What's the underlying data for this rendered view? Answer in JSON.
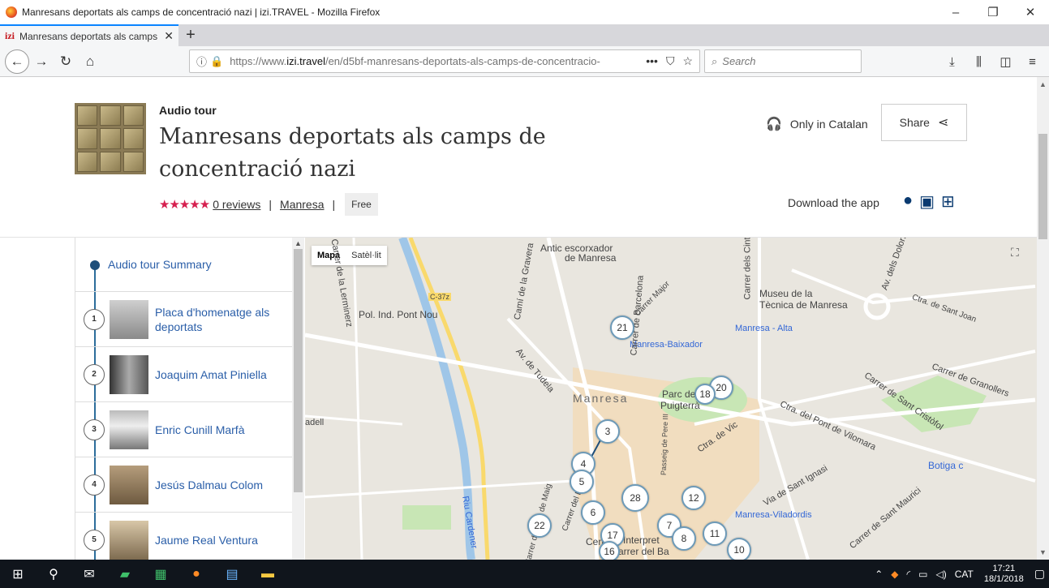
{
  "window": {
    "title": "Manresans deportats als camps de concentració nazi | izi.TRAVEL - Mozilla Firefox"
  },
  "tab": {
    "favicon_text": "izi",
    "title": "Manresans deportats als camps",
    "close": "✕",
    "newtab": "+"
  },
  "nav": {
    "url_prefix": "https://www.",
    "url_domain": "izi.travel",
    "url_rest": "/en/d5bf-manresans-deportats-als-camps-de-concentracio-",
    "search_placeholder": "Search"
  },
  "tour": {
    "type": "Audio tour",
    "title": "Manresans deportats als camps de concentració nazi",
    "stars": "★★★★★",
    "reviews": "0 reviews",
    "city": "Manresa",
    "price": "Free",
    "language": "Only in Catalan",
    "share": "Share",
    "download": "Download the app"
  },
  "sidebar": {
    "summary": "Audio tour Summary",
    "stops": [
      {
        "num": "1",
        "label": "Placa d'homenatge als deportats"
      },
      {
        "num": "2",
        "label": "Joaquim Amat Piniella"
      },
      {
        "num": "3",
        "label": "Enric Cunill Marfà"
      },
      {
        "num": "4",
        "label": "Jesús Dalmau Colom"
      },
      {
        "num": "5",
        "label": "Jaume Real Ventura"
      }
    ]
  },
  "map": {
    "type_map": "Mapa",
    "type_sat": "Satèl·lit",
    "labels": [
      {
        "text": "Antic escorxador",
        "cls": ""
      },
      {
        "text": "de Manresa",
        "cls": ""
      },
      {
        "text": "Museu de la",
        "cls": ""
      },
      {
        "text": "Tècnica de Manresa",
        "cls": ""
      },
      {
        "text": "Pol. Ind. Pont Nou",
        "cls": ""
      },
      {
        "text": "Manresa - Alta",
        "cls": "blue"
      },
      {
        "text": "Manresa-Baixador",
        "cls": "blue"
      },
      {
        "text": "Manresa",
        "cls": "big"
      },
      {
        "text": "Parc de",
        "cls": ""
      },
      {
        "text": "Puigterrà",
        "cls": ""
      },
      {
        "text": "Botiga c",
        "cls": "blue"
      },
      {
        "text": "Manresa-Viladordis",
        "cls": "blue"
      },
      {
        "text": "Riu Cardener",
        "cls": "blue"
      },
      {
        "text": "C-37z",
        "cls": ""
      },
      {
        "text": "Ctra. de Vic",
        "cls": ""
      },
      {
        "text": "Carrer de Granollers",
        "cls": ""
      },
      {
        "text": "Av. de Tudela",
        "cls": ""
      },
      {
        "text": "Carrer dels Cintaires",
        "cls": ""
      },
      {
        "text": "Av. dels Dolors",
        "cls": ""
      },
      {
        "text": "Ctra. del Pont de Vilomara",
        "cls": ""
      },
      {
        "text": "Carrer de Sant Cristòfol",
        "cls": ""
      },
      {
        "text": "Carrer de Barcelona",
        "cls": ""
      },
      {
        "text": "Camí de la Gravera",
        "cls": ""
      },
      {
        "text": "Carrer de la Lerminerz",
        "cls": ""
      },
      {
        "text": "Via de Sant Ignasi",
        "cls": ""
      },
      {
        "text": "Carrer de Sant Maurici",
        "cls": ""
      },
      {
        "text": "Ctra. de Sant Joan",
        "cls": ""
      },
      {
        "text": "Carrer del Bruc",
        "cls": ""
      },
      {
        "text": "Carrer del Dos de Maig",
        "cls": ""
      },
      {
        "text": "Passeig de Pere III",
        "cls": ""
      },
      {
        "text": "Cen",
        "cls": ""
      },
      {
        "text": "Interpret",
        "cls": ""
      },
      {
        "text": "arrer del Ba",
        "cls": ""
      },
      {
        "text": "adell",
        "cls": ""
      },
      {
        "text": "Carrer Major",
        "cls": ""
      }
    ],
    "pins": [
      "21",
      "20",
      "18",
      "3",
      "4",
      "5",
      "28",
      "12",
      "6",
      "22",
      "17",
      "16",
      "7",
      "8",
      "11",
      "10"
    ]
  },
  "taskbar": {
    "lang": "CAT",
    "time": "17:21",
    "date": "18/1/2018"
  }
}
